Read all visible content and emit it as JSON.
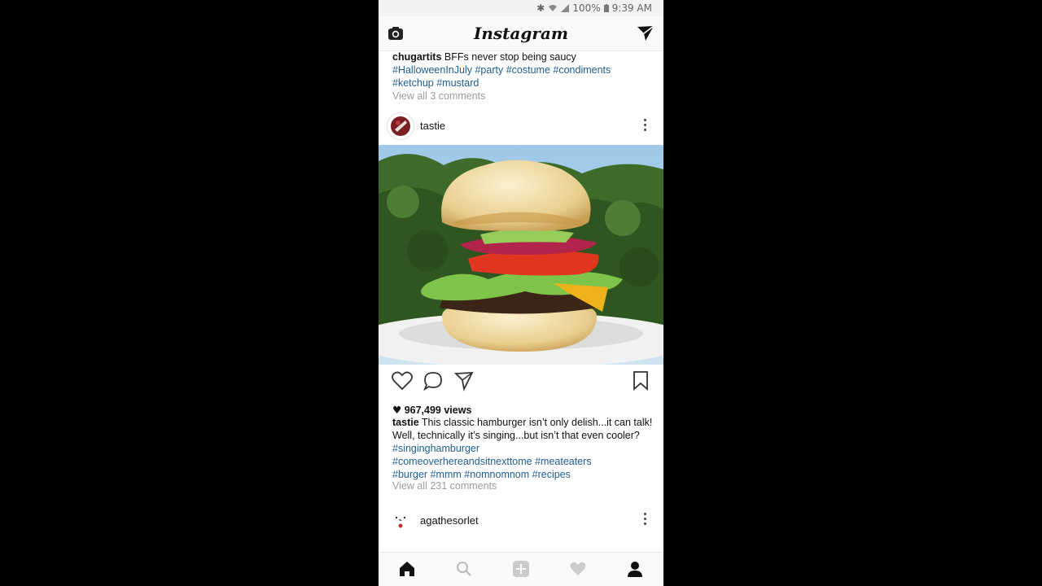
{
  "status_bar": {
    "battery": "100%",
    "time": "9:39 AM"
  },
  "header": {
    "brand": "Instagram",
    "camera_icon": "camera-icon",
    "direct_icon": "direct-send-icon"
  },
  "previous_post": {
    "username": "chugartits",
    "caption_text": "BFFs never stop being saucy",
    "hashtags": [
      "#HalloweenInJuly",
      "#party",
      "#costume",
      "#condiments",
      "#ketchup",
      "#mustard"
    ],
    "view_comments": "View all 3 comments"
  },
  "post": {
    "username": "tastie",
    "views": "967,499 views",
    "caption_text": "This classic hamburger isn’t only delish...it can talk! Well, technically it’s singing...but isn’t that even cooler?",
    "hashtags": [
      "#singinghamburger",
      "#comeoverhereandsitnexttome",
      "#meateaters",
      "#burger",
      "#mmm",
      "#nomnomnom",
      "#recipes"
    ],
    "view_comments": "View all 231 comments",
    "action_icons": [
      "heart-icon",
      "comment-icon",
      "share-icon",
      "bookmark-icon"
    ]
  },
  "next_post": {
    "username": "agathesorlet"
  },
  "bottom_nav": {
    "items": [
      "home-icon",
      "search-icon",
      "add-icon",
      "activity-heart-icon",
      "profile-icon"
    ],
    "active": "home-icon"
  }
}
